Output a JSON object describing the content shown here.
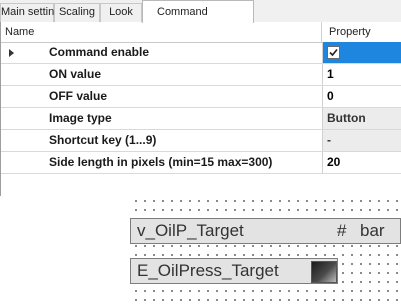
{
  "tabs": [
    "Main settings",
    "Scaling",
    "Look",
    "Command"
  ],
  "active_tab": "Command",
  "grid": {
    "header": {
      "name": "Name",
      "property": "Property"
    },
    "rows": [
      {
        "name": "Command enable",
        "value": "",
        "checked": true,
        "expander": true
      },
      {
        "name": "ON value",
        "value": "1"
      },
      {
        "name": "OFF value",
        "value": "0"
      },
      {
        "name": "Image type",
        "value": "Button",
        "style": "grey"
      },
      {
        "name": "Shortcut key (1...9)",
        "value": "-",
        "style": "grey"
      },
      {
        "name": "Side length in pixels (min=15 max=300)",
        "value": "20"
      }
    ]
  },
  "canvas": {
    "widget1": {
      "tag": "v_OilP_Target",
      "format": "#",
      "unit": "bar"
    },
    "widget2": {
      "tag": "E_OilPress_Target"
    }
  },
  "colors": {
    "selection": "#1f86e0",
    "widget_bg": "#e3e3e3"
  }
}
